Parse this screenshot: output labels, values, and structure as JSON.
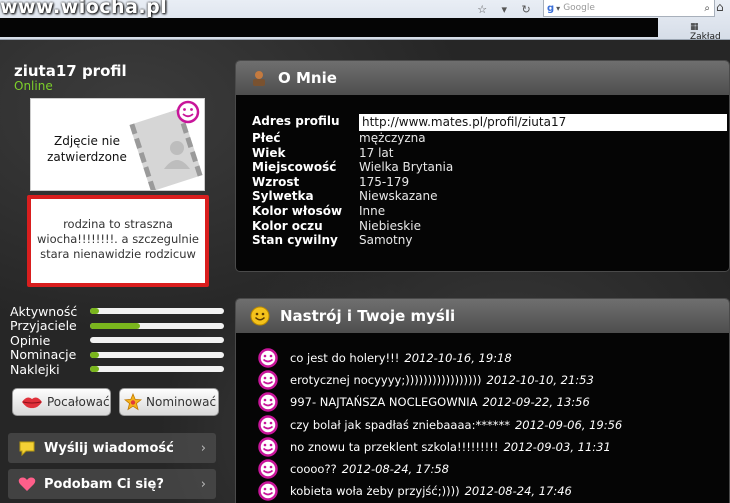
{
  "browser": {
    "watermark": "www.wiocha.pl",
    "search_placeholder": "Google",
    "bookmarks_label": "Zakład"
  },
  "profile": {
    "username": "ziuta17 profil",
    "status": "Online",
    "photo_text": "Zdjęcie nie zatwierdzone",
    "status_message": "rodzina to straszna wiocha!!!!!!!!. a szczegulnie stara nienawidzie rodzicuw"
  },
  "stats": [
    {
      "label": "Aktywność",
      "value": 0.07
    },
    {
      "label": "Przyjaciele",
      "value": 0.37
    },
    {
      "label": "Opinie",
      "value": 0.0
    },
    {
      "label": "Nominacje",
      "value": 0.07
    },
    {
      "label": "Naklejki",
      "value": 0.07
    }
  ],
  "buttons": {
    "kiss": "Pocałować",
    "nominate": "Nominować"
  },
  "menu": {
    "message": "Wyślij wiadomość",
    "like": "Podobam Ci się?"
  },
  "about": {
    "title": "O Mnie",
    "rows": [
      {
        "key": "Adres profilu",
        "value": "http://www.mates.pl/profil/ziuta17"
      },
      {
        "key": "Płeć",
        "value": "mężczyzna"
      },
      {
        "key": "Wiek",
        "value": "17 lat"
      },
      {
        "key": "Miejscowość",
        "value": "Wielka Brytania"
      },
      {
        "key": "Wzrost",
        "value": "175-179"
      },
      {
        "key": "Sylwetka",
        "value": "Niewskazane"
      },
      {
        "key": "Kolor włosów",
        "value": "Inne"
      },
      {
        "key": "Kolor oczu",
        "value": "Niebieskie"
      },
      {
        "key": "Stan cywilny",
        "value": "Samotny"
      }
    ]
  },
  "mood": {
    "title": "Nastrój i Twoje myśli",
    "entries": [
      {
        "text": "co jest do holery!!!",
        "date": "2012-10-16, 19:18"
      },
      {
        "text": "erotycznej nocyyyy;)))))))))))))))))",
        "date": "2012-10-10, 21:53"
      },
      {
        "text": "997- NAJTAŃSZA NOCLEGOWNIA",
        "date": "2012-09-22, 13:56"
      },
      {
        "text": "czy bolał jak spadłaś zniebaaaa:******",
        "date": "2012-09-06, 19:56"
      },
      {
        "text": "no znowu ta przeklent szkola!!!!!!!!!",
        "date": "2012-09-03, 11:31"
      },
      {
        "text": "coooo??",
        "date": "2012-08-24, 17:58"
      },
      {
        "text": "kobieta woła żeby przyjść;))))",
        "date": "2012-08-24, 17:46"
      }
    ]
  },
  "colors": {
    "accent_green": "#7ab51d",
    "online_green": "#7ccf2a",
    "bubble_border": "#d91e1e",
    "smiley_pink": "#c8159a"
  }
}
